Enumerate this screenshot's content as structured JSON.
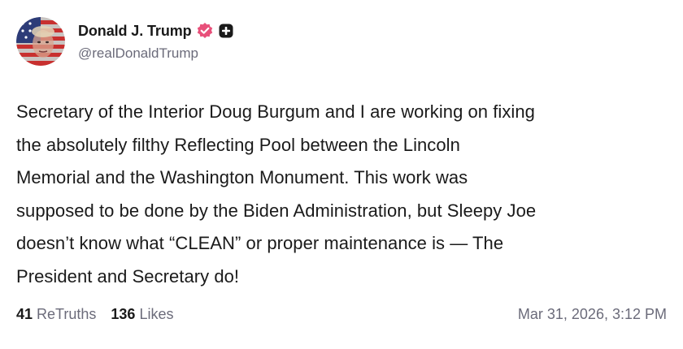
{
  "author": {
    "display_name": "Donald J. Trump",
    "handle": "@realDonaldTrump",
    "avatar": "avatar-american-flag-portrait",
    "verified_icon": "verified-badge-icon",
    "verified_color": "#e8507a",
    "extra_icon": "plus-badge-icon"
  },
  "post": {
    "lines": [
      "Secretary of the Interior Doug Burgum and I are working on fixing",
      "the absolutely filthy Reflecting Pool between the Lincoln",
      "Memorial and the Washington Monument. This work was",
      "supposed to be done by the Biden Administration, but Sleepy Joe",
      "doesn’t know what “CLEAN” or proper maintenance is — The",
      "President and Secretary do!"
    ]
  },
  "stats": {
    "retruths_count": "41",
    "retruths_label": "ReTruths",
    "likes_count": "136",
    "likes_label": "Likes"
  },
  "timestamp": "Mar 31, 2026, 3:12 PM"
}
